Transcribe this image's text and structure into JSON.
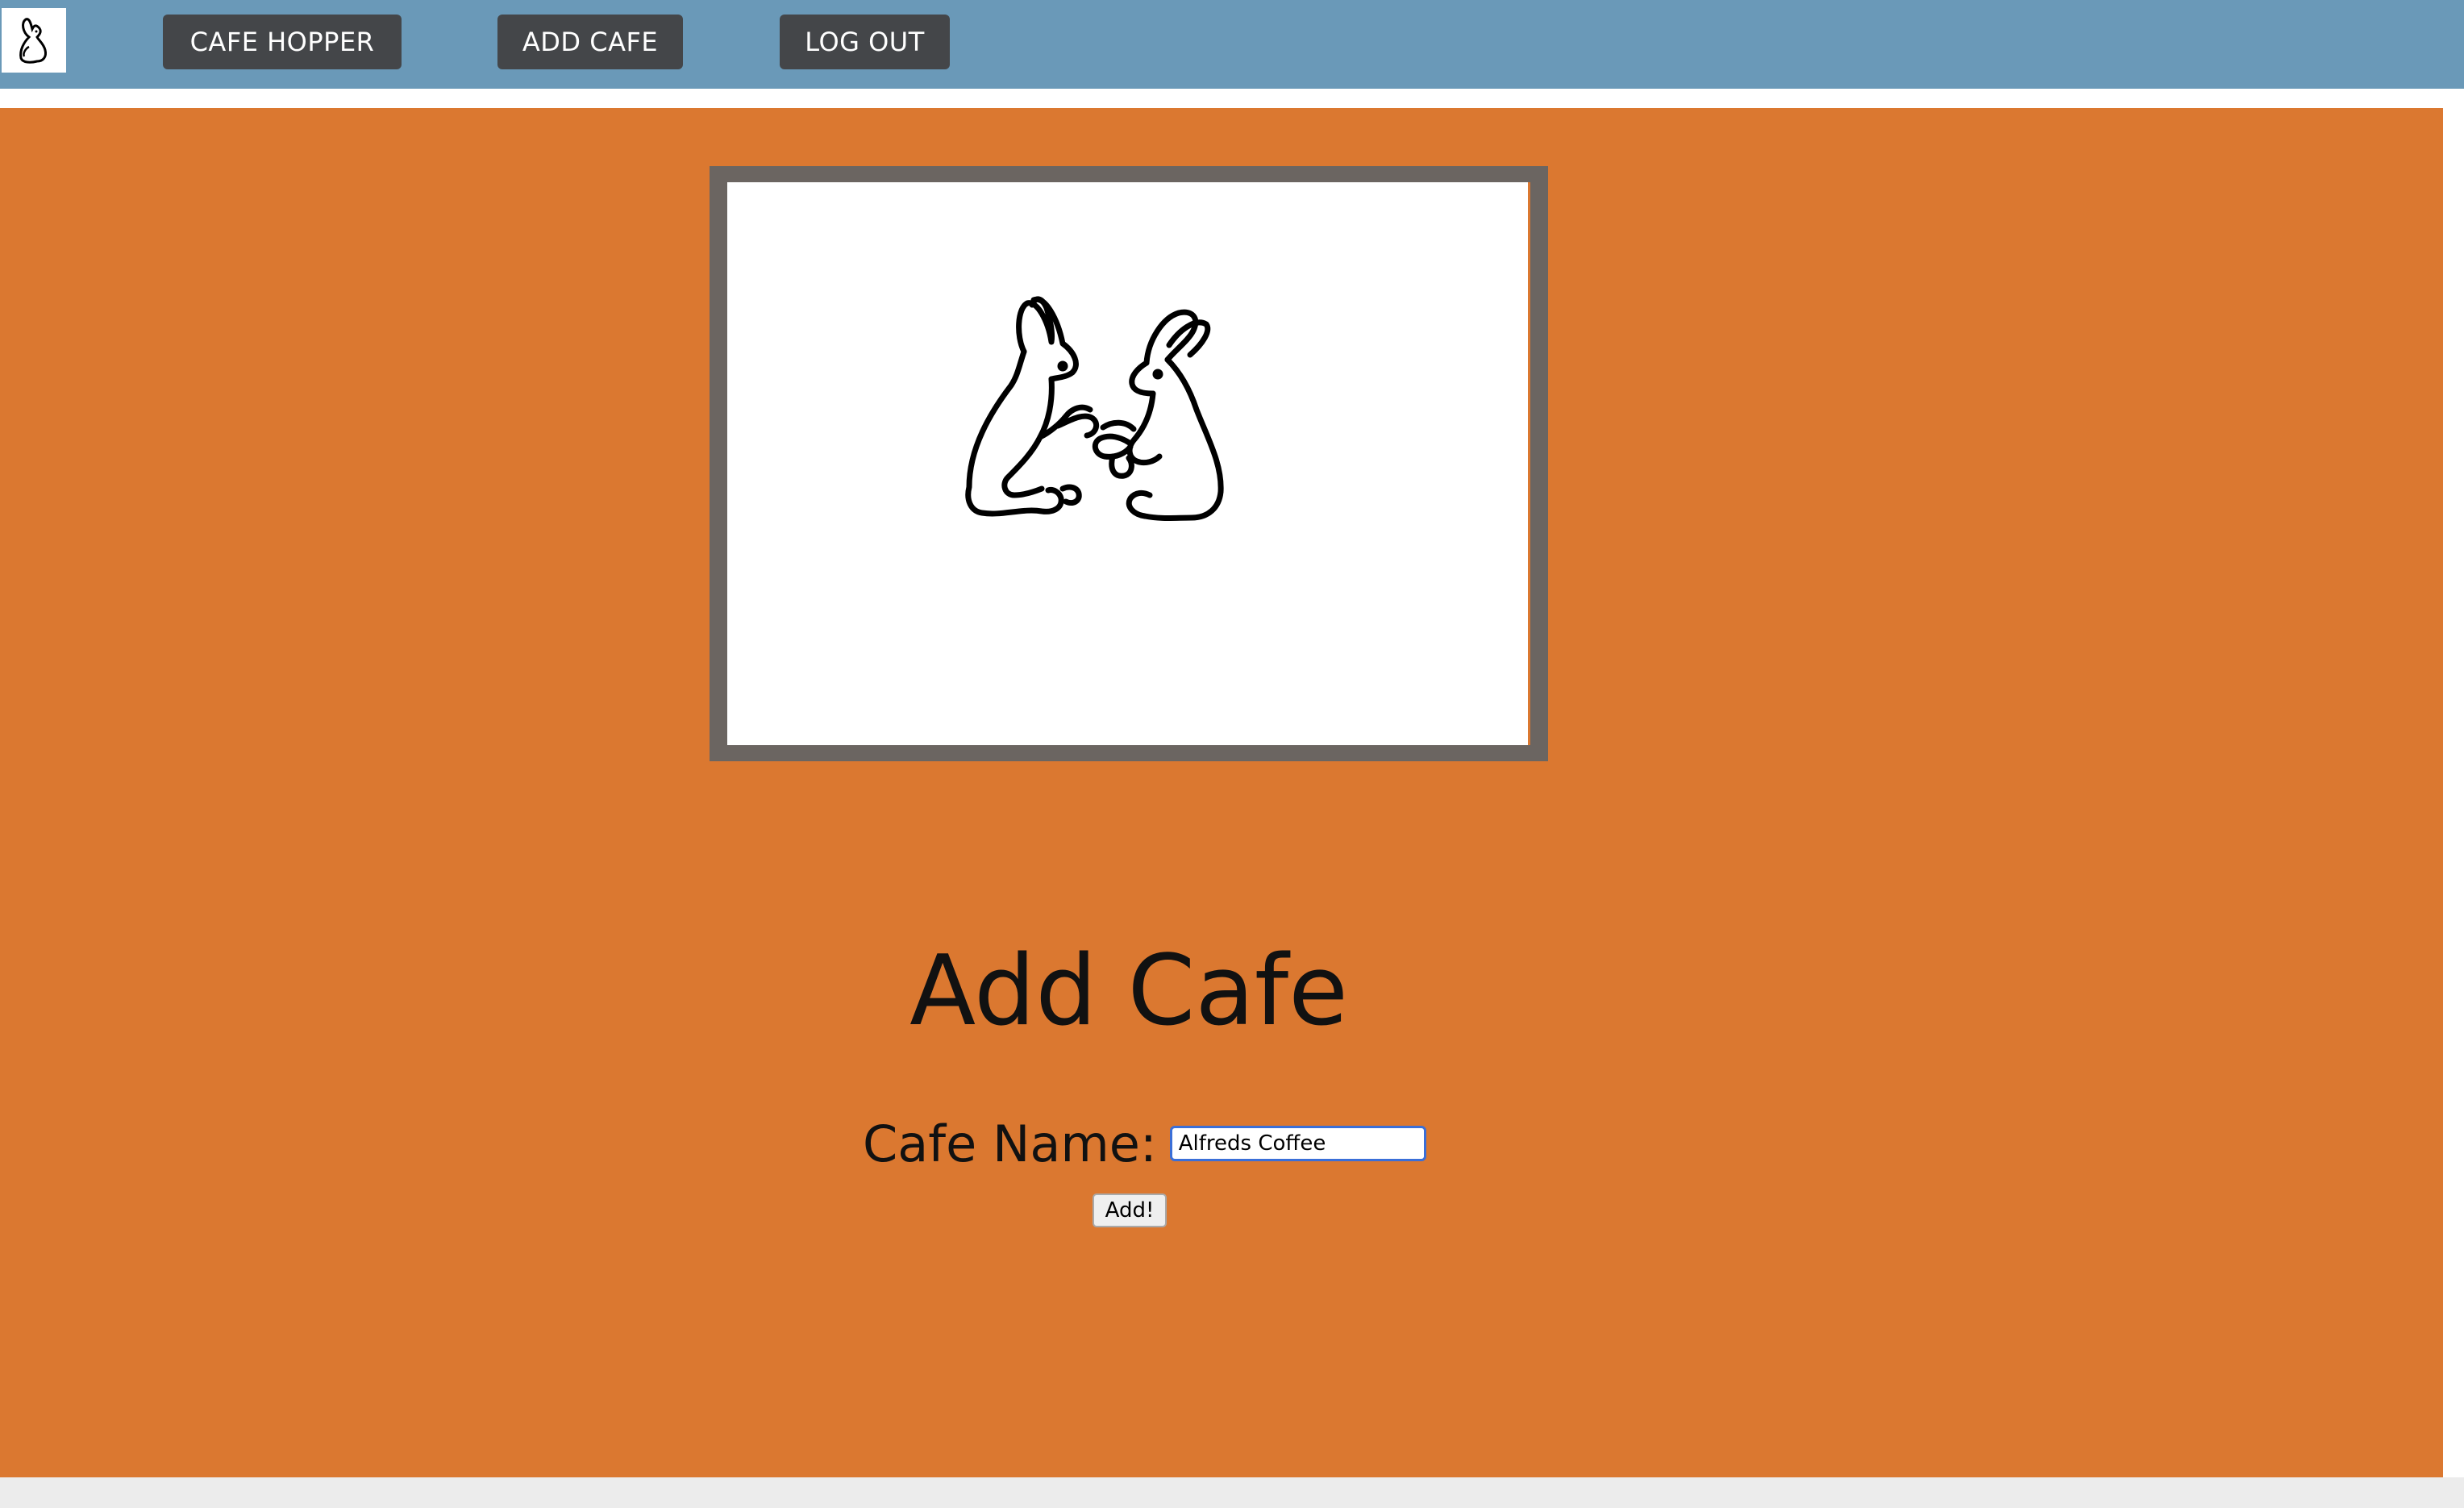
{
  "navbar": {
    "logo_icon": "rabbit-logo-icon",
    "links": [
      {
        "label": "CAFE HOPPER"
      },
      {
        "label": "ADD CAFE"
      },
      {
        "label": "LOG OUT"
      }
    ]
  },
  "hero_image": {
    "icon": "two-rabbits-drawing"
  },
  "page": {
    "title": "Add Cafe"
  },
  "form": {
    "cafe_name_label": "Cafe Name:",
    "cafe_name_value": "Alfreds Coffee",
    "submit_label": "Add!"
  },
  "colors": {
    "navbar": "#6a99b8",
    "nav_button": "#444649",
    "main_background": "#db7830",
    "frame": "#6b6561"
  }
}
